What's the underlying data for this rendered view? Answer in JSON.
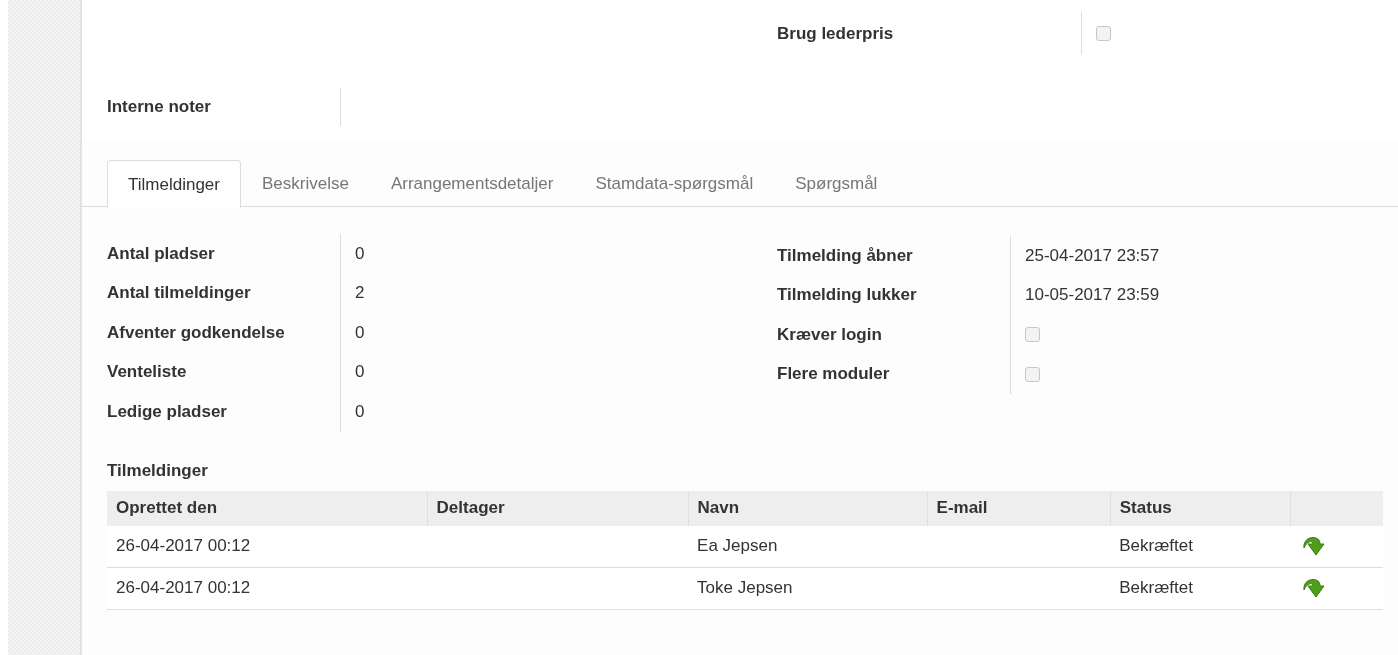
{
  "header_fields": [
    {
      "label": "Brug lederpris",
      "kind": "checkbox",
      "checked": false
    }
  ],
  "notes": {
    "label": "Interne noter"
  },
  "tabs": [
    {
      "label": "Tilmeldinger",
      "selected": true
    },
    {
      "label": "Beskrivelse",
      "selected": false
    },
    {
      "label": "Arrangementsdetaljer",
      "selected": false
    },
    {
      "label": "Stamdata-spørgsmål",
      "selected": false
    },
    {
      "label": "Spørgsmål",
      "selected": false
    }
  ],
  "stats": [
    {
      "label": "Antal pladser",
      "value": "0"
    },
    {
      "label": "Antal tilmeldinger",
      "value": "2"
    },
    {
      "label": "Afventer godkendelse",
      "value": "0"
    },
    {
      "label": "Venteliste",
      "value": "0"
    },
    {
      "label": "Ledige pladser",
      "value": "0"
    }
  ],
  "registration": [
    {
      "label": "Tilmelding åbner",
      "kind": "text",
      "value": "25-04-2017 23:57"
    },
    {
      "label": "Tilmelding lukker",
      "kind": "text",
      "value": "10-05-2017 23:59"
    },
    {
      "label": "Kræver login",
      "kind": "checkbox",
      "checked": false
    },
    {
      "label": "Flere moduler",
      "kind": "checkbox",
      "checked": false
    }
  ],
  "table": {
    "title": "Tilmeldinger",
    "columns": [
      "Oprettet den",
      "Deltager",
      "Navn",
      "E-mail",
      "Status"
    ],
    "rows": [
      {
        "created": "26-04-2017 00:12",
        "name": "Ea Jepsen",
        "status": "Bekræftet"
      },
      {
        "created": "26-04-2017 00:12",
        "name": "Toke Jepsen",
        "status": "Bekræftet"
      }
    ]
  }
}
